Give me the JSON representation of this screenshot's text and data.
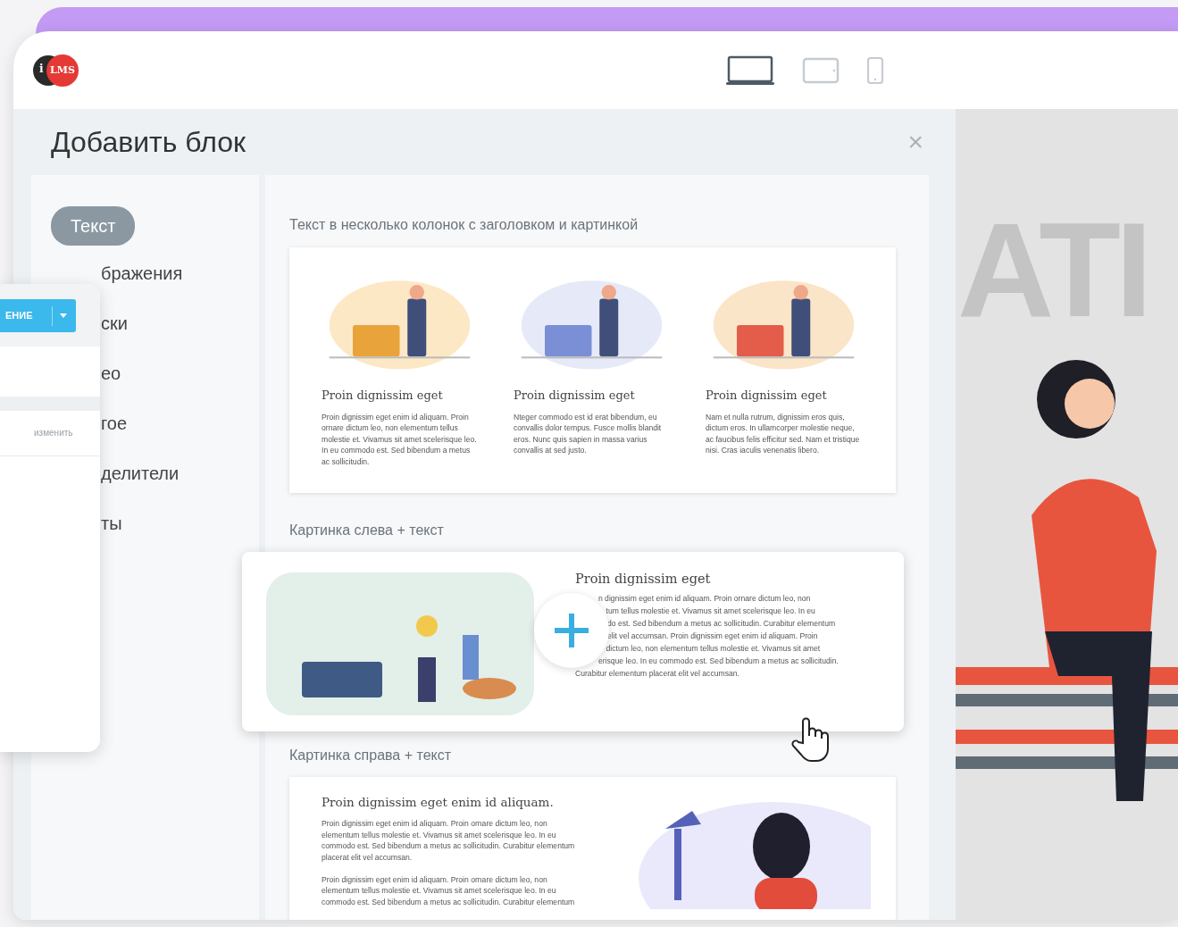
{
  "header": {
    "logo": {
      "letter": "i",
      "text": "LMS"
    },
    "devices": [
      {
        "kind": "desktop",
        "selected": true
      },
      {
        "kind": "tablet",
        "selected": false
      },
      {
        "kind": "phone",
        "selected": false
      }
    ]
  },
  "modal": {
    "title": "Добавить блок",
    "close": "×",
    "categories": [
      {
        "label": "Текст",
        "selected": true
      },
      {
        "label": "бражения",
        "selected": false
      },
      {
        "label": "ски",
        "selected": false
      },
      {
        "label": "ео",
        "selected": false
      },
      {
        "label": "гое",
        "selected": false
      },
      {
        "label": "делители",
        "selected": false
      },
      {
        "label": "ты",
        "selected": false
      }
    ],
    "sections": [
      {
        "kind": "columns",
        "label": "Текст в несколько колонок с заголовком и картинкой",
        "columns": [
          {
            "heading": "Proin dignissim eget",
            "text": "Proin dignissim eget enim id aliquam. Proin ornare dictum leo, non elementum tellus molestie et. Vivamus sit amet scelerisque leo. In eu commodo est. Sed bibendum a metus ac sollicitudin."
          },
          {
            "heading": "Proin dignissim eget",
            "text": "Nteger commodo est id erat bibendum, eu convallis dolor tempus. Fusce mollis blandit eros. Nunc quis sapien in massa varius convallis at sed justo."
          },
          {
            "heading": "Proin dignissim eget",
            "text": "Nam et nulla rutrum, dignissim eros quis, dictum eros. In ullamcorper molestie neque, ac faucibus felis efficitur sed. Nam et tristique nisi. Cras iaculis venenatis libero."
          }
        ]
      },
      {
        "kind": "image_left",
        "label": "Картинка слева + текст",
        "heading": "Proin dignissim eget",
        "lines": [
          "n dignissim eget enim id aliquam. Proin ornare dictum leo, non",
          "tum tellus molestie et. Vivamus sit amet scelerisque leo. In eu",
          "do est. Sed bibendum a metus ac sollicitudin. Curabitur elementum",
          "elit vel accumsan. Proin dignissim eget enim id aliquam. Proin",
          "dictum leo, non elementum tellus molestie et. Vivamus sit amet",
          "erisque leo. In eu commodo est. Sed bibendum a metus ac sollicitudin.",
          "Curabitur elementum placerat elit vel accumsan."
        ]
      },
      {
        "kind": "image_right",
        "label": "Картинка справа + текст",
        "heading": "Proin dignissim eget enim id aliquam.",
        "paragraphs": [
          "Proin dignissim eget enim id aliquam. Proin ornare dictum leo, non elementum tellus molestie et. Vivamus sit amet scelerisque leo. In eu commodo est. Sed bibendum a metus ac sollicitudin. Curabitur elementum placerat elit vel accumsan.",
          "Proin dignissim eget enim id aliquam. Proin ornare dictum leo, non elementum tellus molestie et. Vivamus sit amet scelerisque leo. In eu commodo est. Sed bibendum a metus ac sollicitudin. Curabitur elementum"
        ]
      }
    ]
  },
  "overlay_panel": {
    "button": "ЕНИЕ",
    "link": "изменить"
  },
  "preview": {
    "text": "ATI"
  }
}
